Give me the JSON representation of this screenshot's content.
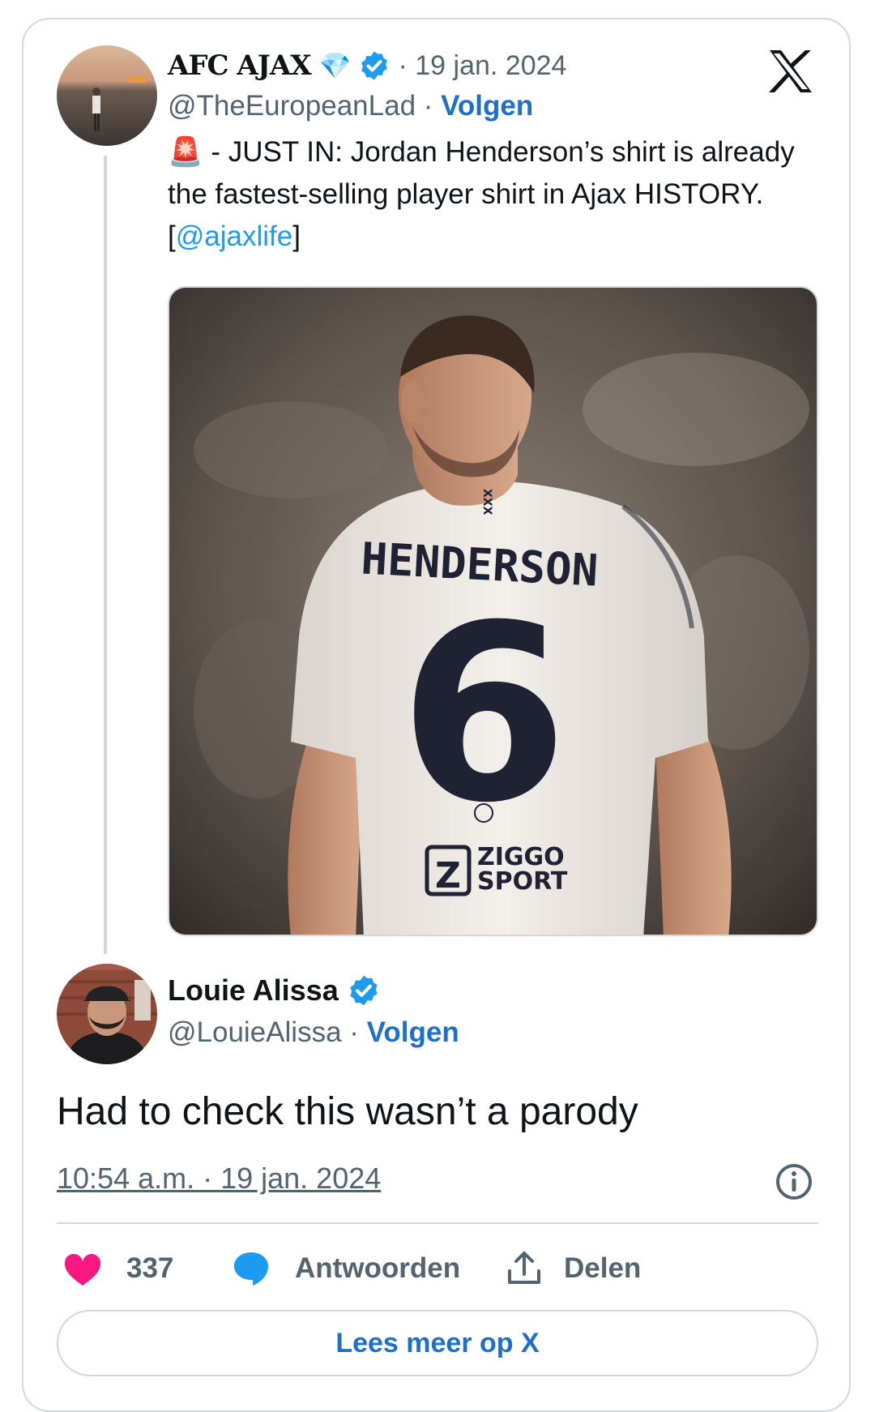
{
  "quoted_tweet": {
    "author_name": "AFC AJAX",
    "gem_emoji": "💎",
    "date": "· 19 jan. 2024",
    "handle": "@TheEuropeanLad",
    "separator": " · ",
    "follow_label": "Volgen",
    "siren_emoji": "🚨",
    "text_part1": " - JUST IN: Jordan Henderson’s shirt is already the fastest-selling player shirt in Ajax HISTORY. [",
    "mention": "@ajaxlife",
    "text_part2": "]",
    "image": {
      "shirt_name": "HENDERSON",
      "shirt_number": "6",
      "collar_text": "XXX",
      "sponsor_mark": "Z",
      "sponsor_line1": "ZIGGO",
      "sponsor_line2": "SPORT"
    }
  },
  "reply_tweet": {
    "author_name": "Louie Alissa",
    "handle": "@LouieAlissa",
    "separator": " · ",
    "follow_label": "Volgen",
    "text": "Had to check this wasn’t a parody",
    "timestamp": "10:54 a.m. · 19 jan. 2024"
  },
  "actions": {
    "like_count": "337",
    "reply_label": "Antwoorden",
    "share_label": "Delen"
  },
  "read_more_label": "Lees meer op X",
  "colors": {
    "accent_blue": "#1d9bf0",
    "follow_blue": "#1d6fc9",
    "like_pink": "#f91880",
    "border": "#cfd9de"
  },
  "icons": [
    "x-logo-icon",
    "verified-badge-icon",
    "heart-icon",
    "reply-bubble-icon",
    "share-icon",
    "info-icon"
  ]
}
